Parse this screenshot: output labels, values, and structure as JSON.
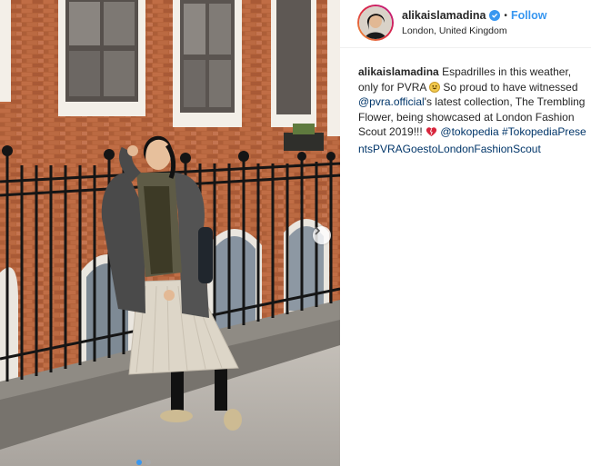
{
  "post": {
    "username": "alikaislamadina",
    "follow_label": "Follow",
    "separator": "•",
    "location": "London, United Kingdom"
  },
  "caption": {
    "username": "alikaislamadina",
    "text_1": "Espadrilles in this weather, only for PVRA",
    "text_2": "So proud to have witnessed",
    "mention_1": "@pvra.official",
    "text_3": "'s latest collection, The Trembling Flower, being showcased at London Fashion Scout 2019!!!",
    "mention_2": "@tokopedia",
    "hashtag": "#TokopediaPresentsPVRAGoestoLondonFashionScout"
  },
  "icons": {
    "verified": "verified-badge-icon",
    "next": "chevron-right-icon",
    "emoji_1": "grinning-emoji-icon",
    "emoji_2": "heart-emoji-icon"
  },
  "colors": {
    "link": "#3897f0",
    "mention": "#003569",
    "text": "#262626"
  },
  "carousel": {
    "slides": 2,
    "active": 1
  }
}
